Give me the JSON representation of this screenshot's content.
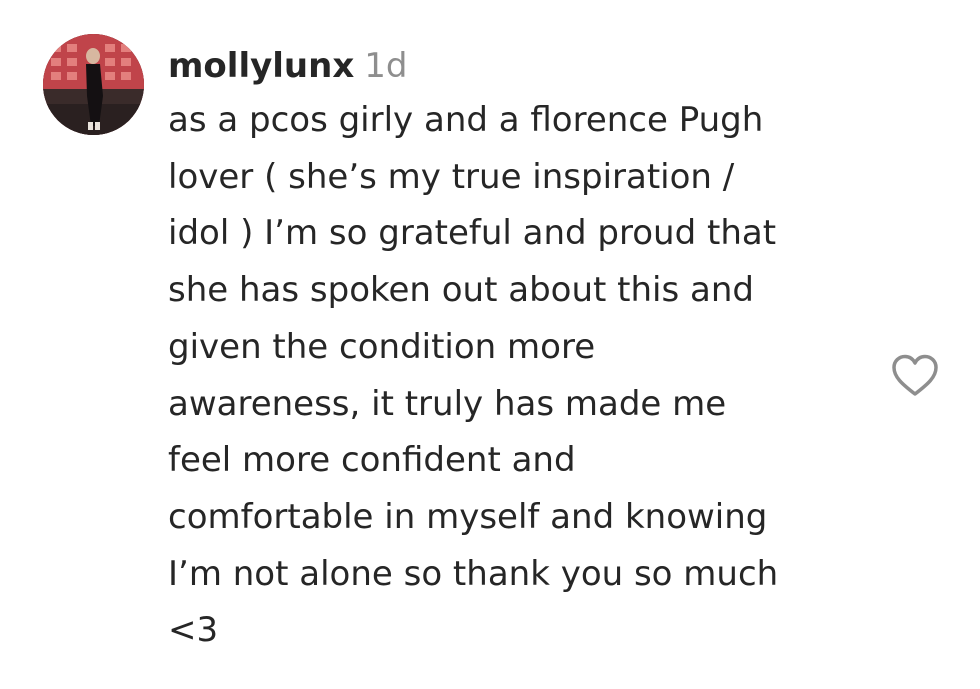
{
  "comment": {
    "author": "mollylunx",
    "time_ago": "1d",
    "text_lines": [
      "as a pcos girly and a florence Pugh",
      "lover ( she’s my true inspiration /",
      "idol ) I’m so grateful and proud that",
      "she has spoken out about this and",
      "given the condition more",
      "awareness, it truly has made me",
      "feel more confident and",
      "comfortable in myself and knowing",
      "I’m not alone so thank you so much",
      "<3"
    ],
    "avatar_icon": "profile-photo",
    "like_icon": "heart-outline-icon"
  },
  "colors": {
    "text": "#262626",
    "muted": "#8e8e8e",
    "icon": "#8e8e8e"
  }
}
